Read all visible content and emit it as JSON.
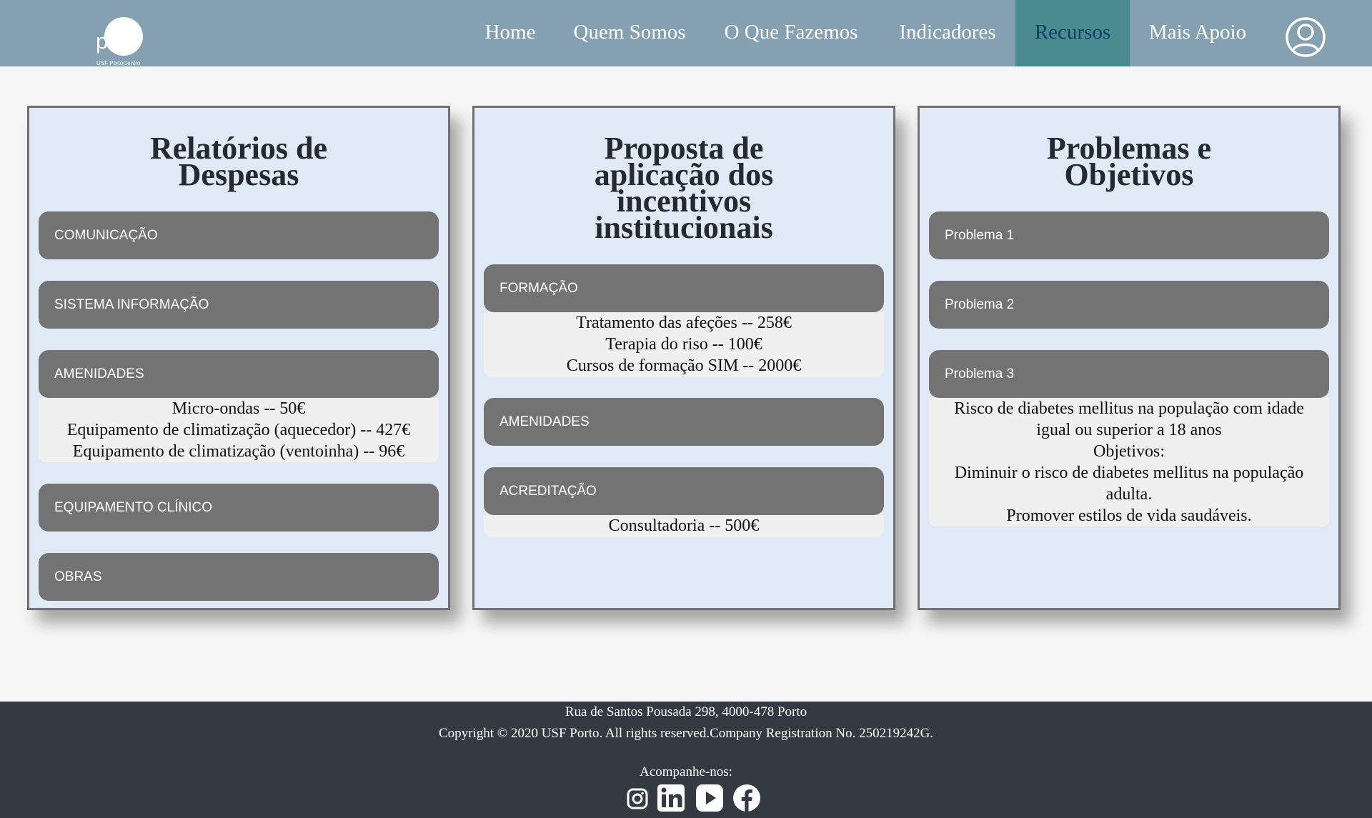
{
  "logo": {
    "mark": "pc",
    "subtitle": "USF PortoCentro"
  },
  "nav": {
    "items": [
      {
        "label": "Home"
      },
      {
        "label": "Quem Somos"
      },
      {
        "label": "O Que Fazemos"
      },
      {
        "label": "Indicadores"
      },
      {
        "label": "Recursos"
      },
      {
        "label": "Mais Apoio"
      }
    ],
    "active": "Recursos",
    "user_icon": "user-circle-icon"
  },
  "cards": [
    {
      "title_line1": "Relatórios de",
      "title_line2": "Despesas",
      "items": [
        {
          "label": "COMUNICAÇÃO"
        },
        {
          "label": "SISTEMA INFORMAÇÃO"
        },
        {
          "label": "AMENIDADES",
          "details": [
            "Micro-ondas -- 50€",
            "Equipamento de climatização (aquecedor) -- 427€",
            "Equipamento de climatização (ventoinha) -- 96€"
          ]
        },
        {
          "label": "EQUIPAMENTO CLÍNICO"
        },
        {
          "label": "OBRAS"
        }
      ]
    },
    {
      "title_line1": "Proposta de",
      "title_line2": "aplicação dos",
      "title_line3": "incentivos",
      "title_line4": "institucionais",
      "items": [
        {
          "label": "FORMAÇÃO",
          "details": [
            "Tratamento das afeções -- 258€",
            "Terapia do riso -- 100€",
            "Cursos de formação SIM -- 2000€"
          ]
        },
        {
          "label": "AMENIDADES"
        },
        {
          "label": "ACREDITAÇÃO",
          "details": [
            "Consultadoria -- 500€"
          ]
        }
      ]
    },
    {
      "title_line1": "Problemas e",
      "title_line2": "Objetivos",
      "items": [
        {
          "label": "Problema 1"
        },
        {
          "label": "Problema 2"
        },
        {
          "label": "Problema 3",
          "details": [
            "Risco de diabetes mellitus na população com idade",
            "igual ou superior a 18 anos",
            "Objetivos:",
            "Diminuir o risco de diabetes mellitus na população",
            "adulta.",
            "Promover estilos de vida saudáveis."
          ]
        }
      ]
    }
  ],
  "footer": {
    "address": "Rua de Santos Pousada 298, 4000-478 Porto",
    "copyright": "Copyright © 2020 USF Porto. All rights reserved.Company Registration No. 250219242G.",
    "follow": "Acompanhe-nos:",
    "socials": [
      "instagram-icon",
      "linkedin-icon",
      "youtube-icon",
      "facebook-icon"
    ]
  },
  "colors": {
    "navbar": "#85a0b0",
    "nav_active_bg": "#4a8b8f",
    "nav_active_text": "#0e3d6a",
    "card_bg": "#dfeaf6",
    "pill_bg": "#737373",
    "panel_bg": "#f0f0f0",
    "footer_bg": "#333a41"
  }
}
